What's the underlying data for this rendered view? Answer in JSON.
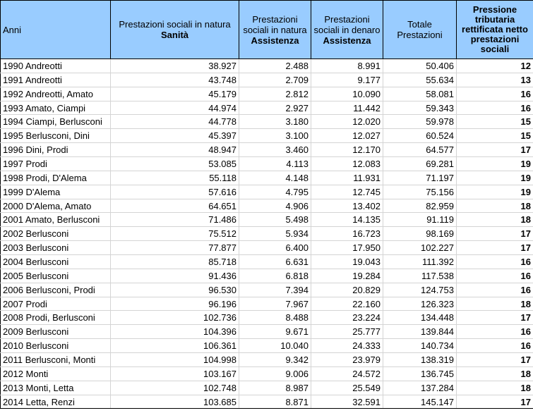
{
  "header": {
    "anni": "Anni",
    "sanita_line1": "Prestazioni sociali in natura",
    "sanita_line2": "Sanità",
    "ass_natura_line1": "Prestazioni sociali in natura",
    "ass_natura_line2": "Assistenza",
    "ass_denaro_line1": "Prestazioni sociali in denaro",
    "ass_denaro_line2": "Assistenza",
    "totale": "Totale Prestazioni",
    "pressione": "Pressione tributaria rettificata netto prestazioni sociali"
  },
  "rows": [
    {
      "anni": "1990 Andreotti",
      "sanita": "38.927",
      "ass_natura": "2.488",
      "ass_denaro": "8.991",
      "totale": "50.406",
      "pressione": "12"
    },
    {
      "anni": "1991 Andreotti",
      "sanita": "43.748",
      "ass_natura": "2.709",
      "ass_denaro": "9.177",
      "totale": "55.634",
      "pressione": "13"
    },
    {
      "anni": "1992 Andreotti, Amato",
      "sanita": "45.179",
      "ass_natura": "2.812",
      "ass_denaro": "10.090",
      "totale": "58.081",
      "pressione": "16"
    },
    {
      "anni": "1993 Amato, Ciampi",
      "sanita": "44.974",
      "ass_natura": "2.927",
      "ass_denaro": "11.442",
      "totale": "59.343",
      "pressione": "16"
    },
    {
      "anni": "1994 Ciampi, Berlusconi",
      "sanita": "44.778",
      "ass_natura": "3.180",
      "ass_denaro": "12.020",
      "totale": "59.978",
      "pressione": "15"
    },
    {
      "anni": "1995 Berlusconi, Dini",
      "sanita": "45.397",
      "ass_natura": "3.100",
      "ass_denaro": "12.027",
      "totale": "60.524",
      "pressione": "15"
    },
    {
      "anni": "1996 Dini, Prodi",
      "sanita": "48.947",
      "ass_natura": "3.460",
      "ass_denaro": "12.170",
      "totale": "64.577",
      "pressione": "17"
    },
    {
      "anni": "1997 Prodi",
      "sanita": "53.085",
      "ass_natura": "4.113",
      "ass_denaro": "12.083",
      "totale": "69.281",
      "pressione": "19"
    },
    {
      "anni": "1998 Prodi, D'Alema",
      "sanita": "55.118",
      "ass_natura": "4.148",
      "ass_denaro": "11.931",
      "totale": "71.197",
      "pressione": "19"
    },
    {
      "anni": "1999 D'Alema",
      "sanita": "57.616",
      "ass_natura": "4.795",
      "ass_denaro": "12.745",
      "totale": "75.156",
      "pressione": "19"
    },
    {
      "anni": "2000 D'Alema, Amato",
      "sanita": "64.651",
      "ass_natura": "4.906",
      "ass_denaro": "13.402",
      "totale": "82.959",
      "pressione": "18"
    },
    {
      "anni": "2001 Amato, Berlusconi",
      "sanita": "71.486",
      "ass_natura": "5.498",
      "ass_denaro": "14.135",
      "totale": "91.119",
      "pressione": "18"
    },
    {
      "anni": "2002 Berlusconi",
      "sanita": "75.512",
      "ass_natura": "5.934",
      "ass_denaro": "16.723",
      "totale": "98.169",
      "pressione": "17"
    },
    {
      "anni": "2003 Berlusconi",
      "sanita": "77.877",
      "ass_natura": "6.400",
      "ass_denaro": "17.950",
      "totale": "102.227",
      "pressione": "17"
    },
    {
      "anni": "2004 Berlusconi",
      "sanita": "85.718",
      "ass_natura": "6.631",
      "ass_denaro": "19.043",
      "totale": "111.392",
      "pressione": "16"
    },
    {
      "anni": "2005 Berlusconi",
      "sanita": "91.436",
      "ass_natura": "6.818",
      "ass_denaro": "19.284",
      "totale": "117.538",
      "pressione": "16"
    },
    {
      "anni": "2006 Berlusconi, Prodi",
      "sanita": "96.530",
      "ass_natura": "7.394",
      "ass_denaro": "20.829",
      "totale": "124.753",
      "pressione": "16"
    },
    {
      "anni": "2007 Prodi",
      "sanita": "96.196",
      "ass_natura": "7.967",
      "ass_denaro": "22.160",
      "totale": "126.323",
      "pressione": "18"
    },
    {
      "anni": "2008 Prodi, Berlusconi",
      "sanita": "102.736",
      "ass_natura": "8.488",
      "ass_denaro": "23.224",
      "totale": "134.448",
      "pressione": "17"
    },
    {
      "anni": "2009 Berlusconi",
      "sanita": "104.396",
      "ass_natura": "9.671",
      "ass_denaro": "25.777",
      "totale": "139.844",
      "pressione": "16"
    },
    {
      "anni": "2010 Berlusconi",
      "sanita": "106.361",
      "ass_natura": "10.040",
      "ass_denaro": "24.333",
      "totale": "140.734",
      "pressione": "16"
    },
    {
      "anni": "2011 Berlusconi, Monti",
      "sanita": "104.998",
      "ass_natura": "9.342",
      "ass_denaro": "23.979",
      "totale": "138.319",
      "pressione": "17"
    },
    {
      "anni": "2012 Monti",
      "sanita": "103.167",
      "ass_natura": "9.006",
      "ass_denaro": "24.572",
      "totale": "136.745",
      "pressione": "18"
    },
    {
      "anni": "2013 Monti, Letta",
      "sanita": "102.748",
      "ass_natura": "8.987",
      "ass_denaro": "25.549",
      "totale": "137.284",
      "pressione": "18"
    },
    {
      "anni": "2014 Letta, Renzi",
      "sanita": "103.685",
      "ass_natura": "8.871",
      "ass_denaro": "32.591",
      "totale": "145.147",
      "pressione": "17"
    }
  ]
}
